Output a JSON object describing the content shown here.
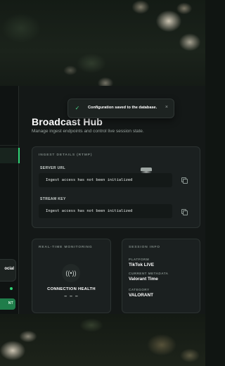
{
  "header": {
    "title": "Broadcast Hub",
    "subtitle": "Manage ingest endpoints and control live session state."
  },
  "toast": {
    "icon": "check-icon",
    "message": "Configuration saved to the database.",
    "close": "×"
  },
  "sidebar": {
    "card_text": "ocial",
    "button_label": "NT"
  },
  "ingest": {
    "section_label": "INGEST DETAILS (RTMP)",
    "server_url": {
      "label": "SERVER URL",
      "value": "Ingest access has not been initialized"
    },
    "stream_key": {
      "label": "STREAM KEY",
      "value": "Ingest access has not been initialized"
    }
  },
  "monitoring": {
    "section_label": "REAL-TIME MONITORING",
    "icon": "broadcast-icon",
    "title": "CONNECTION HEALTH",
    "value": "– – –"
  },
  "session": {
    "section_label": "SESSION INFO",
    "platform_key": "PLATFORM",
    "platform_value": "TikTok LIVE",
    "metadata_key": "CURRENT METADATA",
    "metadata_value": "Valorant Time",
    "category_key": "CATEGORY",
    "category_value": "VALORANT"
  },
  "colors": {
    "accent": "#2fd476",
    "background": "#141817",
    "card": "#1b2020"
  }
}
